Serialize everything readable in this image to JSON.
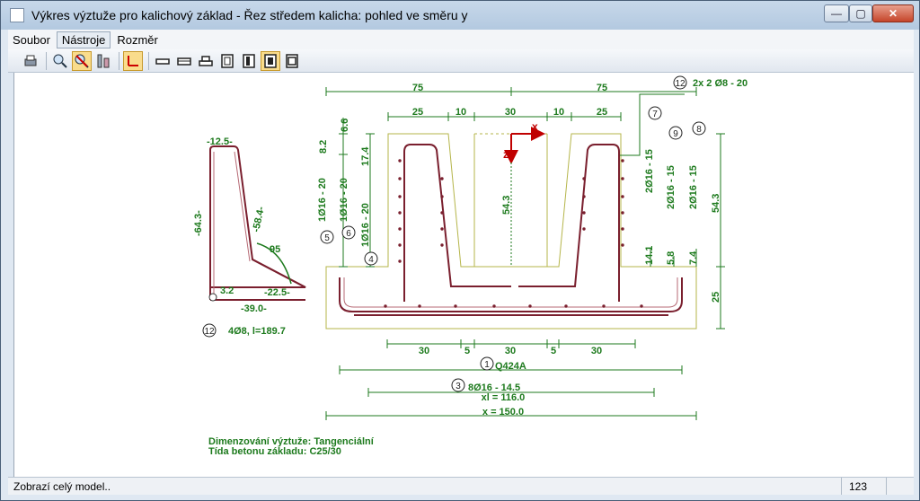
{
  "window": {
    "title": "Výkres výztuže pro kalichový základ - Řez středem kalicha: pohled ve směru y",
    "min_glyph": "—",
    "max_glyph": "▢",
    "close_glyph": "✕"
  },
  "menu": {
    "items": [
      "Soubor",
      "Nástroje",
      "Rozměr"
    ],
    "active": "Nástroje"
  },
  "toolbar": {
    "icons": [
      "print-icon",
      "zoom-icon",
      "zoom-extents-icon",
      "stirrup-icon",
      "axes-icon",
      "view-1-icon",
      "view-2-icon",
      "view-3-icon",
      "view-4-icon",
      "view-5-icon",
      "view-6-icon",
      "view-7-icon"
    ]
  },
  "drawing": {
    "colors": {
      "dim": "#1d7a1d",
      "rebar": "#7a1f2e",
      "concrete": "#b5b54a",
      "axis": "#c00000"
    },
    "dims": {
      "top_left": "75",
      "top_right": "75",
      "seg1": "25",
      "seg2": "10",
      "seg3": "30",
      "seg4": "10",
      "seg5": "25",
      "v_8_2": "8.2",
      "v_6_6": "6.6",
      "v_17_4": "17.4",
      "v_54_3_mid": "54.3",
      "v_54_3_right": "54.3",
      "v_14_1": "14.1",
      "v_5_8": "5.8",
      "v_7_4": "7.4",
      "v_25": "25",
      "bot_30a": "30",
      "bot_5a": "5",
      "bot_30b": "30",
      "bot_5b": "5",
      "bot_30c": "30",
      "xl": "xl = 116.0",
      "x": "x = 150.0"
    },
    "bars": {
      "b5": "1Ø16 - 20",
      "b6": "1Ø16 - 20",
      "b4": "1Ø16 - 20",
      "b7": "2Ø16 - 15",
      "b9": "2Ø16 - 15",
      "b8": "2Ø16 - 15",
      "b12": "2x 2 Ø8 - 20",
      "b1": "Q424A",
      "b3": "8Ø16 - 14.5"
    },
    "markers": {
      "m1": "1",
      "m3": "3",
      "m4": "4",
      "m5": "5",
      "m6": "6",
      "m7": "7",
      "m8": "8",
      "m9": "9",
      "m12": "12",
      "m12b": "12"
    },
    "axes": {
      "x": "x",
      "z": "z"
    },
    "detail": {
      "top": "-12.5-",
      "left": "-64.3-",
      "slope": "-58.4-",
      "angle": "95",
      "foot": "-22.5-",
      "bottom": "-39.0-",
      "radius": "3.2",
      "caption": "4Ø8, l=189.7"
    },
    "notes": {
      "line1": "Dimenzování  výztuže:  Tangenciální",
      "line2": "Tída betonu základu:  C25/30"
    }
  },
  "status": {
    "text": "Zobrazí celý model..",
    "number": "123"
  }
}
